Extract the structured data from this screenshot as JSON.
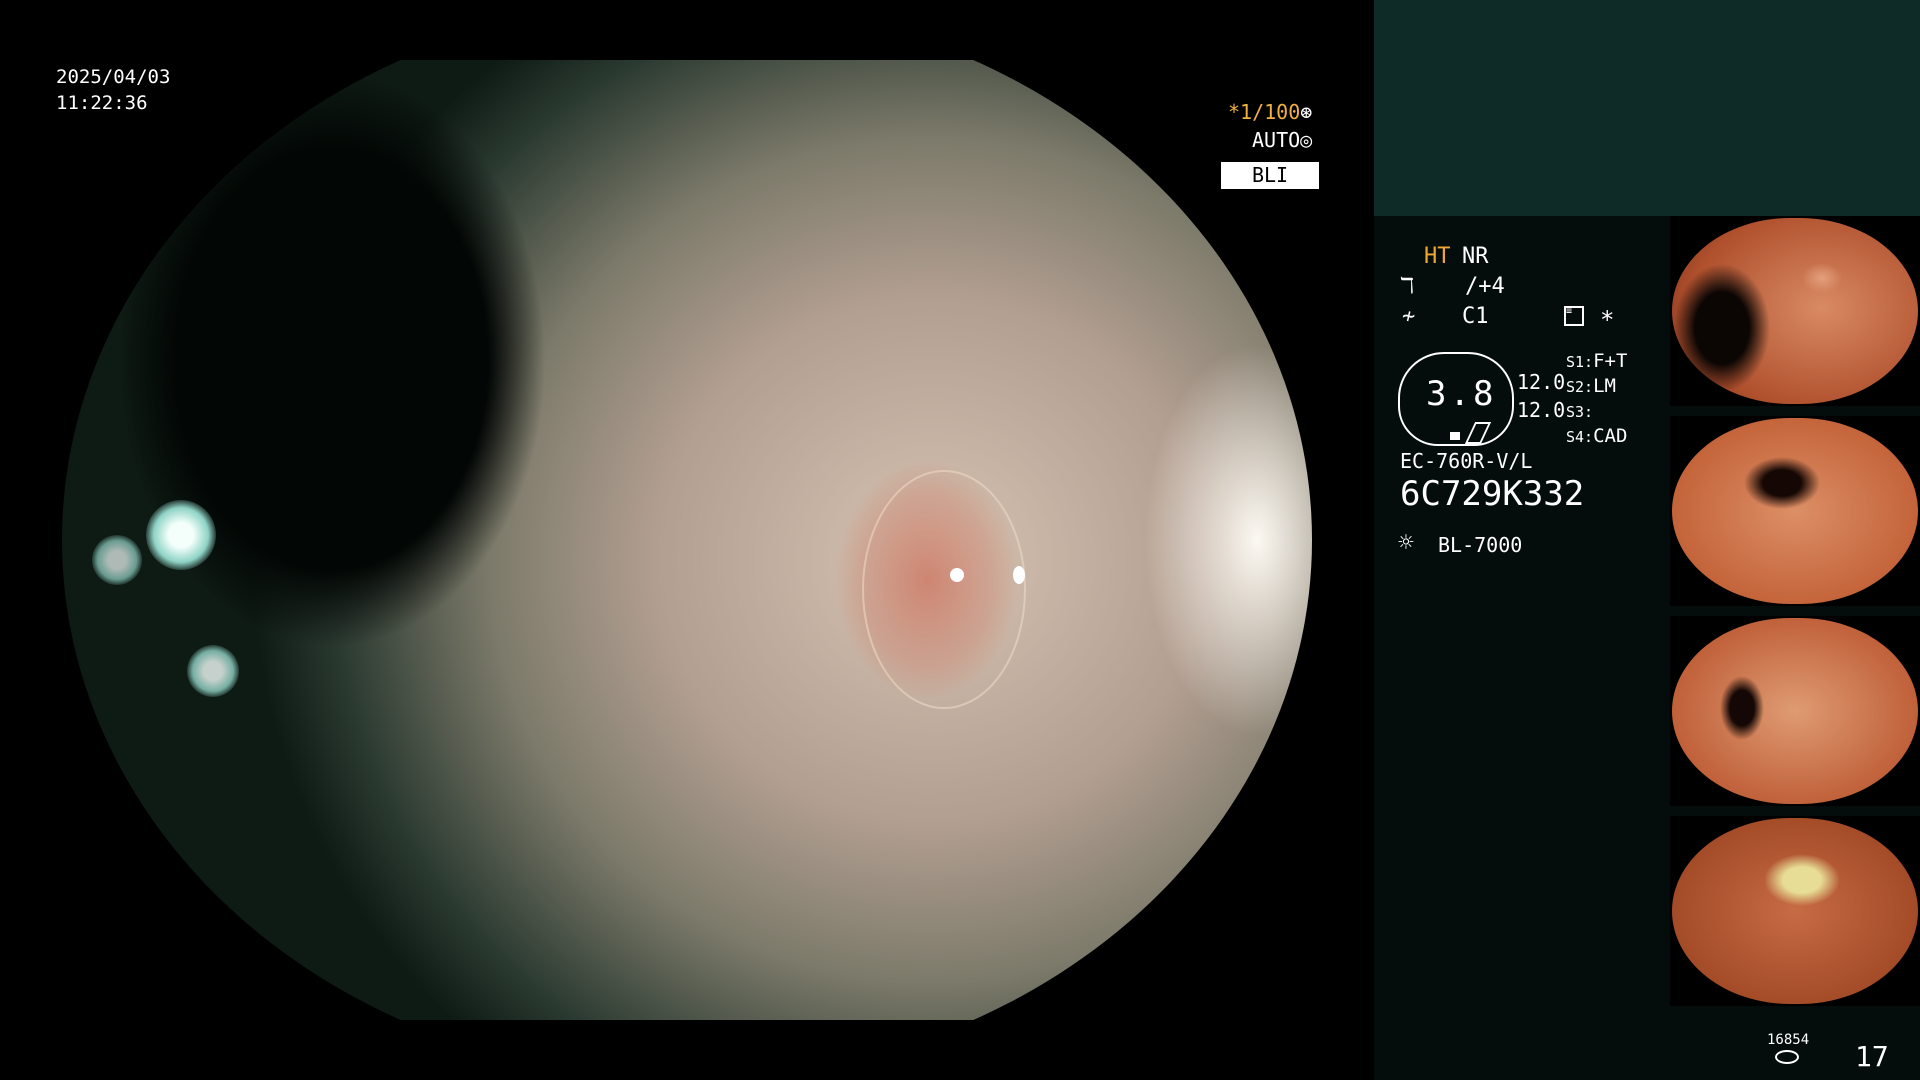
{
  "overlay": {
    "date": "2025/04/03",
    "time": "11:22:36",
    "shutter": "*1/100",
    "shutter_icon": "aperture-icon",
    "iris_mode": "AUTO",
    "iris_icon": "iris-icon",
    "light_mode": "BLI"
  },
  "panel": {
    "ht": "HT",
    "nr": "NR",
    "enhance_value": "/+4",
    "color_value": "C1",
    "star": "*",
    "iris_value": "3.8",
    "value_1": "12.0",
    "value_2": "12.0",
    "slots": [
      {
        "key": "S1:",
        "value": "F+T"
      },
      {
        "key": "S2:",
        "value": "LM"
      },
      {
        "key": "S3:",
        "value": ""
      },
      {
        "key": "S4:",
        "value": "CAD"
      }
    ],
    "scope_model": "EC-760R-V/L",
    "serial": "6C729K332",
    "light_source": "BL-7000",
    "count_small": "16854",
    "count_big": "17"
  },
  "colors": {
    "accent_orange": "#f0a830",
    "teal_block": "#0e2b28"
  }
}
